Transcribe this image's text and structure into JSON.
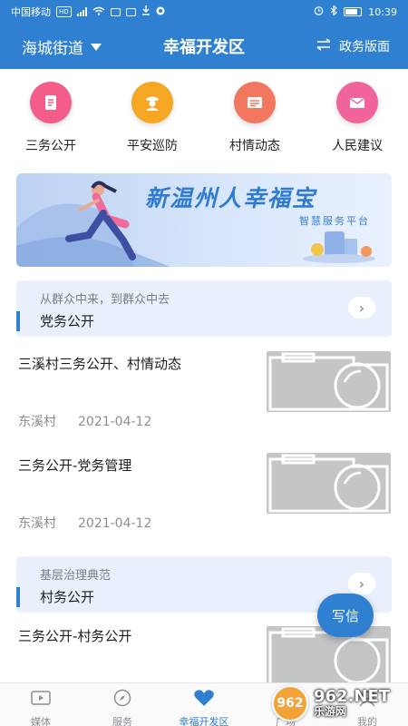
{
  "status_bar": {
    "carrier": "中国移动",
    "badge": "HD",
    "time": "10:39"
  },
  "header": {
    "location": "海城街道",
    "title": "幸福开发区",
    "right_label": "政务版面"
  },
  "quick_icons": [
    {
      "label": "三务公开",
      "color": "#f45c8a",
      "icon": "document-icon"
    },
    {
      "label": "平安巡防",
      "color": "#f5a623",
      "icon": "police-icon"
    },
    {
      "label": "村情动态",
      "color": "#f1785f",
      "icon": "news-icon"
    },
    {
      "label": "人民建议",
      "color": "#f1639b",
      "icon": "mail-icon"
    }
  ],
  "banner": {
    "title": "新温州人幸福宝",
    "subtitle": "智慧服务平台"
  },
  "sections": [
    {
      "subtitle": "从群众中来，到群众中去",
      "title": "党务公开"
    },
    {
      "subtitle": "基层治理典范",
      "title": "村务公开"
    }
  ],
  "articles": [
    {
      "title": "三溪村三务公开、村情动态",
      "source": "东溪村",
      "date": "2021-04-12"
    },
    {
      "title": "三务公开-党务管理",
      "source": "东溪村",
      "date": "2021-04-12"
    },
    {
      "title": "三务公开-村务公开"
    }
  ],
  "fab_label": "写信",
  "bottom_nav": [
    {
      "label": "媒体",
      "icon": "media-icon",
      "active": false
    },
    {
      "label": "服务",
      "icon": "compass-icon",
      "active": false
    },
    {
      "label": "幸福开发区",
      "icon": "heart-icon",
      "active": true
    },
    {
      "label": "广场",
      "icon": "chat-icon",
      "active": false
    },
    {
      "label": "我的",
      "icon": "profile-icon",
      "active": false
    }
  ],
  "watermark": {
    "logo": "962",
    "site": "962.NET",
    "sub": "乐游网"
  },
  "colors": {
    "primary": "#2f80d1",
    "section_bg": "#e9f0fb"
  }
}
